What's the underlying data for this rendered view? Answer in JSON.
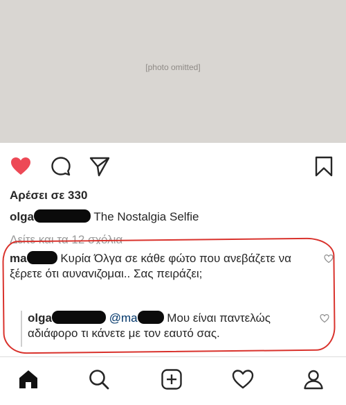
{
  "photo": {
    "note": "[photo omitted]"
  },
  "post": {
    "likes_text": "Αρέσει σε 330",
    "caption": {
      "username_visible": "olga",
      "text": "The Nostalgia Selfie"
    },
    "view_comments_text": "Δείτε και τα 12 σχόλια"
  },
  "comments": [
    {
      "username_visible": "ma",
      "text": "Κυρία Όλγα σε κάθε φώτο που ανεβάζετε να ξέρετε ότι αυναvιζομαι.. Σας πειράζει;"
    },
    {
      "username_visible": "olga",
      "mention": "@ma",
      "text": "Μου είναι παντελώς αδιάφορο τι κάνετε με τον εαυτό σας."
    }
  ],
  "icons": {
    "like": "heart-icon",
    "comment": "comment-icon",
    "share": "send-icon",
    "save": "bookmark-icon",
    "tabs": [
      "home-icon",
      "search-icon",
      "add-post-icon",
      "activity-heart-icon",
      "profile-icon"
    ]
  },
  "colors": {
    "like_red": "#ed4956",
    "annotation_red": "#d9322c",
    "text": "#262626",
    "muted": "#9a9a9a"
  }
}
